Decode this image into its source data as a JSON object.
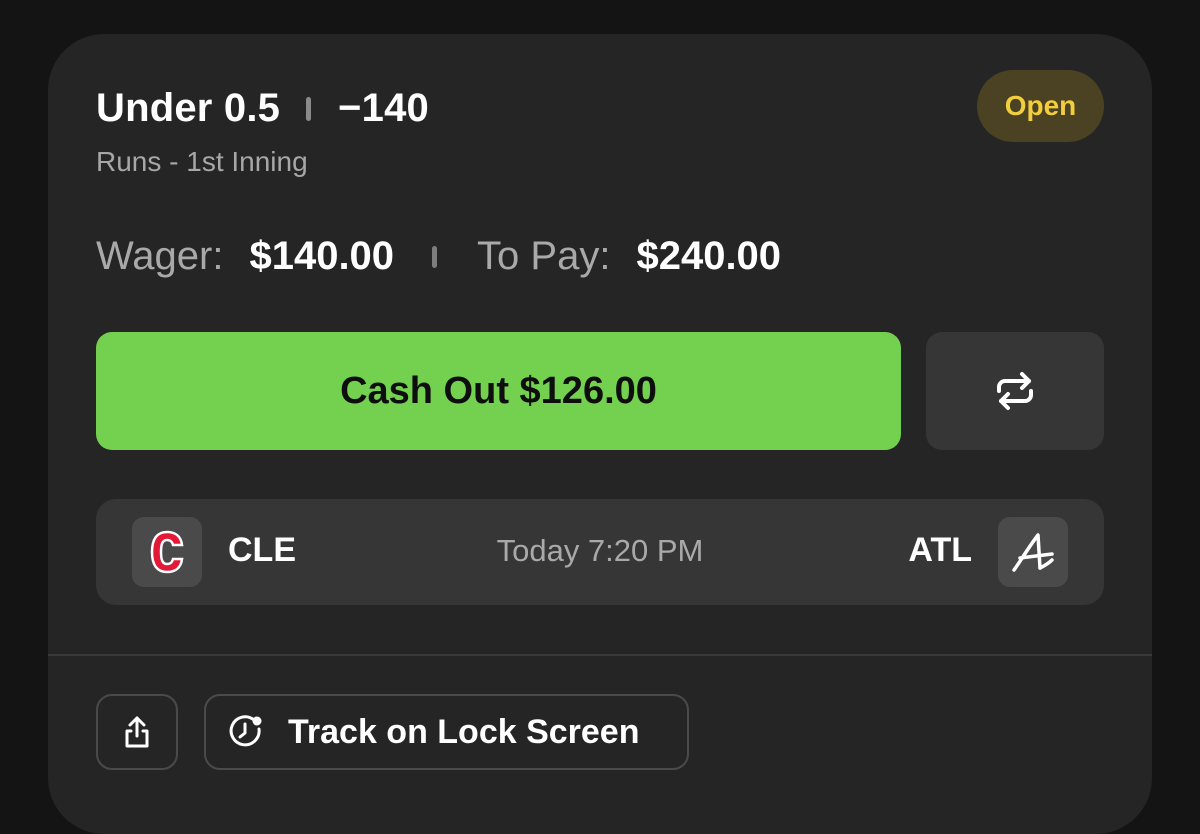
{
  "bet": {
    "selection": "Under 0.5",
    "odds": "−140",
    "market": "Runs - 1st Inning",
    "status": "Open"
  },
  "amounts": {
    "wager_label": "Wager:",
    "wager_value": "$140.00",
    "to_pay_label": "To Pay:",
    "to_pay_value": "$240.00"
  },
  "actions": {
    "cashout_label": "Cash Out $126.00",
    "track_label": "Track on Lock Screen"
  },
  "game": {
    "home_team": "CLE",
    "away_team": "ATL",
    "time": "Today 7:20 PM"
  },
  "icons": {
    "swap": "swap-arrows-icon",
    "share": "share-icon",
    "track": "lock-screen-clock-icon"
  },
  "colors": {
    "background": "#141414",
    "card": "#252525",
    "cashout_green": "#73d14f",
    "status_text": "#f2cd3d",
    "status_bg": "#4a4222",
    "guardians_red": "#e31937",
    "guardians_navy": "#0c2340"
  }
}
